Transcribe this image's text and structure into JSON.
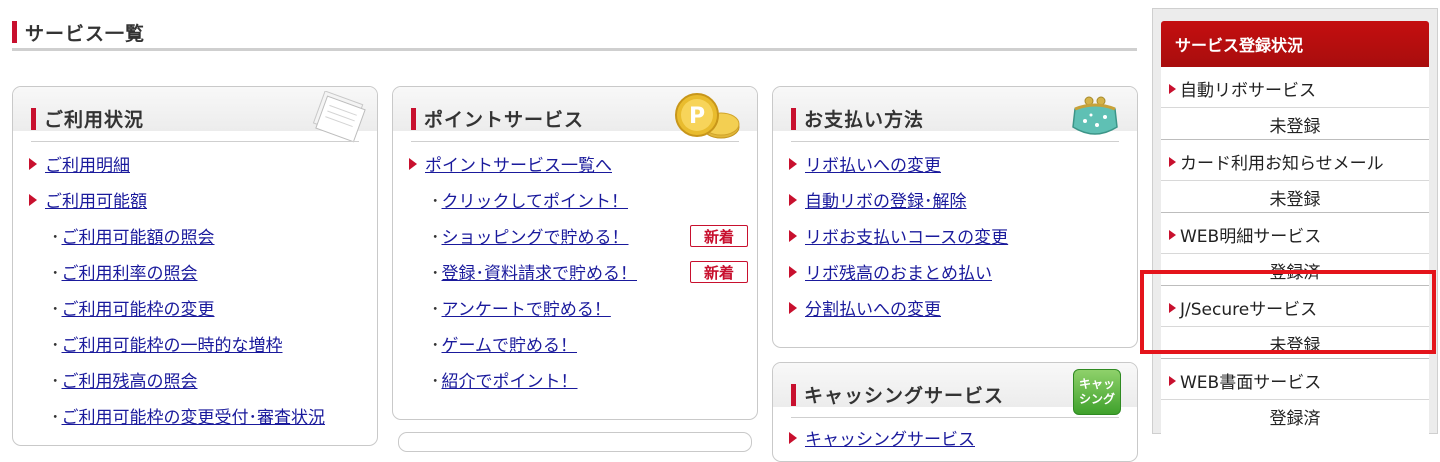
{
  "page": {
    "title": "サービス一覧"
  },
  "usage_panel": {
    "title": "ご利用状況",
    "icon": "documents-icon",
    "items": [
      {
        "label": "ご利用明細",
        "style": "arrow"
      },
      {
        "label": "ご利用可能額",
        "style": "arrow"
      },
      {
        "label": "ご利用可能額の照会",
        "style": "dot"
      },
      {
        "label": "ご利用利率の照会",
        "style": "dot"
      },
      {
        "label": "ご利用可能枠の変更",
        "style": "dot"
      },
      {
        "label": "ご利用可能枠の一時的な増枠",
        "style": "dot"
      },
      {
        "label": "ご利用残高の照会",
        "style": "dot"
      },
      {
        "label": "ご利用可能枠の変更受付･審査状況",
        "style": "dot"
      }
    ]
  },
  "point_panel": {
    "title": "ポイントサービス",
    "icon": "point-coin-icon",
    "items": [
      {
        "label": "ポイントサービス一覧へ",
        "style": "arrow"
      },
      {
        "label": "クリックしてポイント！",
        "style": "dot"
      },
      {
        "label": "ショッピングで貯める！",
        "style": "dot",
        "badge": "新着"
      },
      {
        "label": "登録･資料請求で貯める！",
        "style": "dot",
        "badge": "新着"
      },
      {
        "label": "アンケートで貯める！",
        "style": "dot"
      },
      {
        "label": "ゲームで貯める！",
        "style": "dot"
      },
      {
        "label": "紹介でポイント！",
        "style": "dot"
      }
    ]
  },
  "payment_panel": {
    "title": "お支払い方法",
    "icon": "coin-purse-icon",
    "items": [
      {
        "label": "リボ払いへの変更",
        "style": "arrow"
      },
      {
        "label": "自動リボの登録･解除",
        "style": "arrow"
      },
      {
        "label": "リボお支払いコースの変更",
        "style": "arrow"
      },
      {
        "label": "リボ残高のおまとめ払い",
        "style": "arrow"
      },
      {
        "label": "分割払いへの変更",
        "style": "arrow"
      }
    ]
  },
  "cashing_panel": {
    "title": "キャッシングサービス",
    "icon": "cashing-badge-icon",
    "icon_text": "キャッシング",
    "first_item_partial": "キャッシングサービス"
  },
  "sidebar": {
    "title": "サービス登録状況",
    "services": [
      {
        "name": "自動リボサービス",
        "status": "未登録"
      },
      {
        "name": "カード利用お知らせメール",
        "status": "未登録"
      },
      {
        "name": "WEB明細サービス",
        "status": "登録済"
      },
      {
        "name": "J/Secureサービス",
        "status": "未登録",
        "highlighted": true
      },
      {
        "name": "WEB書面サービス",
        "status": "登録済"
      }
    ]
  },
  "colors": {
    "accent": "#c8102e",
    "link": "#1a1a9c",
    "highlight": "#e4141b"
  }
}
